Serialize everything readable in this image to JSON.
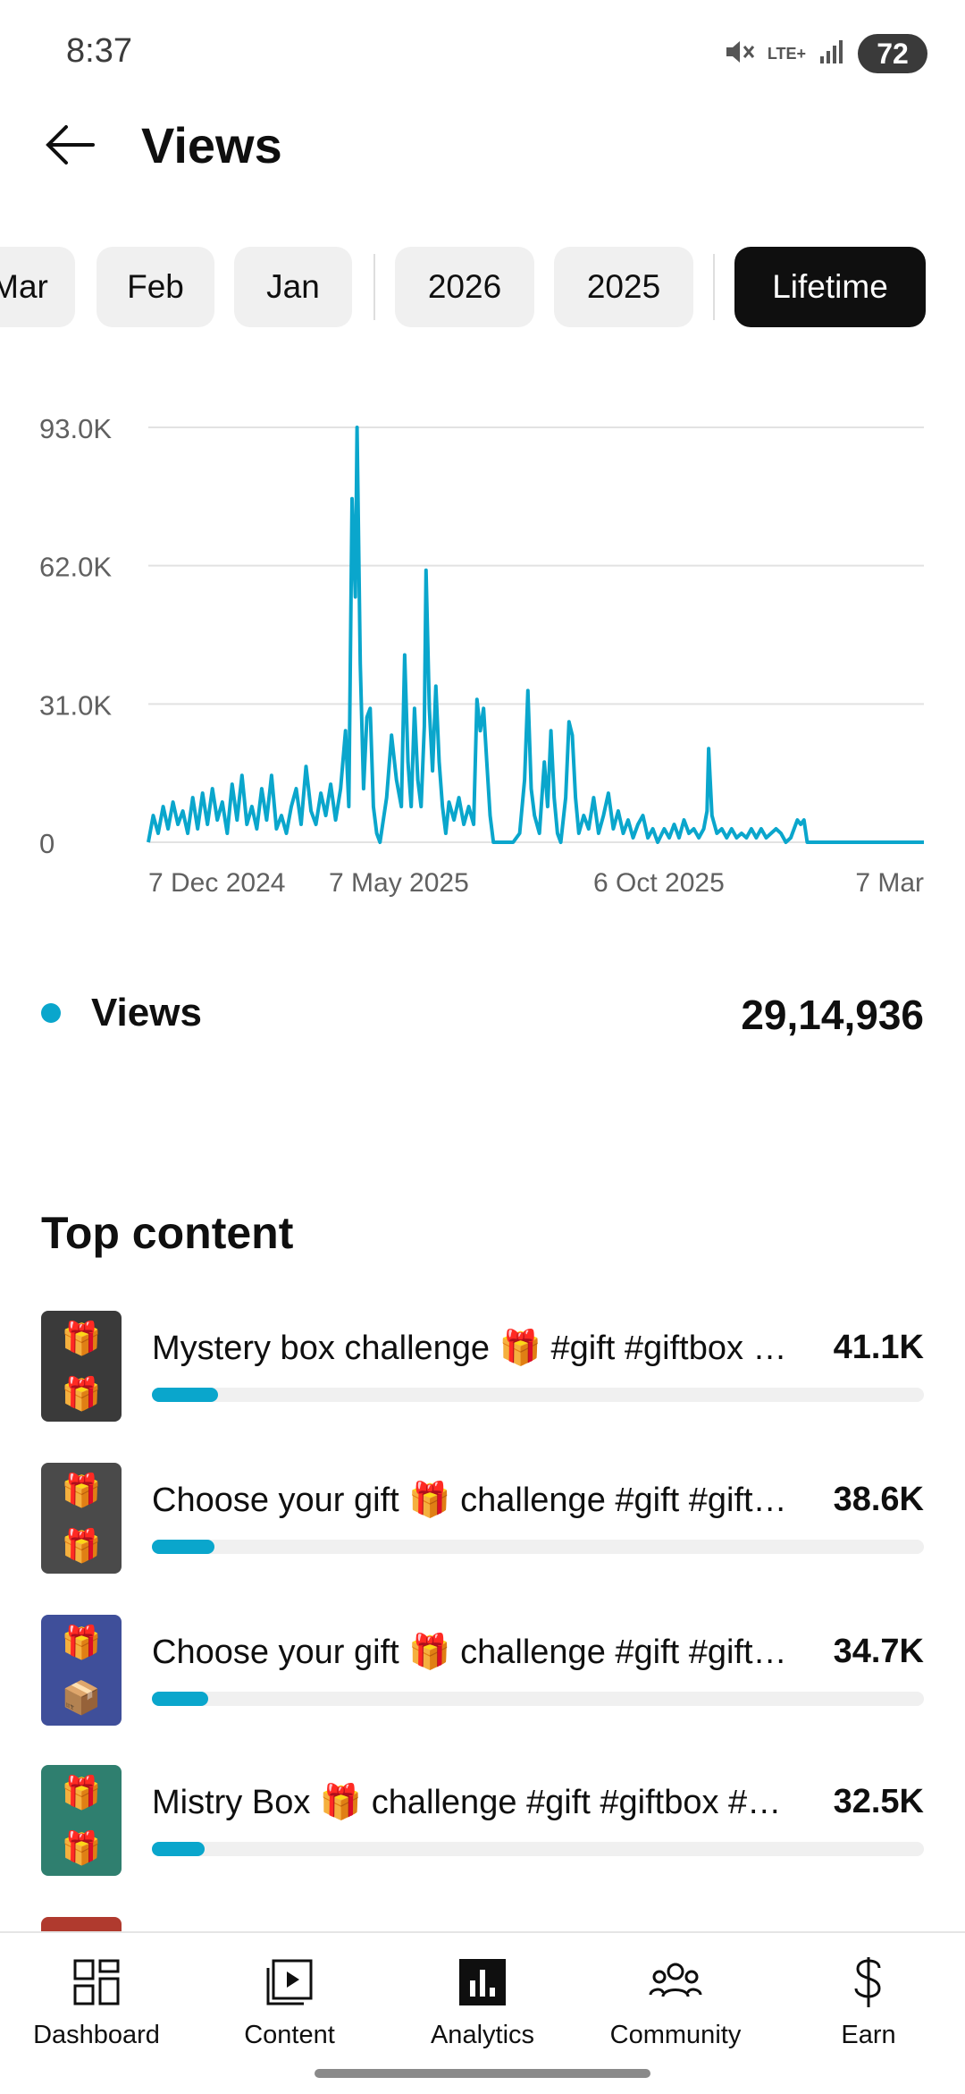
{
  "status_bar": {
    "time": "8:37",
    "network": "LTE+",
    "battery": "72"
  },
  "header": {
    "title": "Views"
  },
  "chips": [
    {
      "label": "Mar",
      "active": false
    },
    {
      "label": "Feb",
      "active": false
    },
    {
      "label": "Jan",
      "active": false
    },
    {
      "label": "2026",
      "active": false
    },
    {
      "label": "2025",
      "active": false
    },
    {
      "label": "Lifetime",
      "active": true
    }
  ],
  "chart_data": {
    "type": "line",
    "series": [
      {
        "name": "Views",
        "color": "#0aa6cc",
        "points": [
          [
            "2024-11-20",
            0
          ],
          [
            "2024-11-23",
            6000
          ],
          [
            "2024-11-26",
            2000
          ],
          [
            "2024-11-29",
            8000
          ],
          [
            "2024-12-02",
            3000
          ],
          [
            "2024-12-05",
            9000
          ],
          [
            "2024-12-08",
            4000
          ],
          [
            "2024-12-11",
            7000
          ],
          [
            "2024-12-14",
            2000
          ],
          [
            "2024-12-17",
            10000
          ],
          [
            "2024-12-20",
            3000
          ],
          [
            "2024-12-23",
            11000
          ],
          [
            "2024-12-26",
            4000
          ],
          [
            "2024-12-29",
            12000
          ],
          [
            "2025-01-01",
            5000
          ],
          [
            "2025-01-04",
            9000
          ],
          [
            "2025-01-07",
            2000
          ],
          [
            "2025-01-10",
            13000
          ],
          [
            "2025-01-13",
            5000
          ],
          [
            "2025-01-16",
            15000
          ],
          [
            "2025-01-19",
            4000
          ],
          [
            "2025-01-22",
            8000
          ],
          [
            "2025-01-25",
            3000
          ],
          [
            "2025-01-28",
            12000
          ],
          [
            "2025-01-31",
            5000
          ],
          [
            "2025-02-03",
            15000
          ],
          [
            "2025-02-06",
            3000
          ],
          [
            "2025-02-09",
            6000
          ],
          [
            "2025-02-12",
            2000
          ],
          [
            "2025-02-15",
            8000
          ],
          [
            "2025-02-18",
            12000
          ],
          [
            "2025-02-21",
            4000
          ],
          [
            "2025-02-24",
            17000
          ],
          [
            "2025-02-27",
            7000
          ],
          [
            "2025-03-02",
            4000
          ],
          [
            "2025-03-05",
            11000
          ],
          [
            "2025-03-08",
            6000
          ],
          [
            "2025-03-11",
            13000
          ],
          [
            "2025-03-14",
            5000
          ],
          [
            "2025-03-17",
            12000
          ],
          [
            "2025-03-20",
            25000
          ],
          [
            "2025-03-22",
            8000
          ],
          [
            "2025-03-24",
            77000
          ],
          [
            "2025-03-26",
            55000
          ],
          [
            "2025-03-27",
            93000
          ],
          [
            "2025-03-29",
            40000
          ],
          [
            "2025-03-31",
            12000
          ],
          [
            "2025-04-02",
            28000
          ],
          [
            "2025-04-04",
            30000
          ],
          [
            "2025-04-06",
            8000
          ],
          [
            "2025-04-08",
            2000
          ],
          [
            "2025-04-10",
            0
          ],
          [
            "2025-04-14",
            10000
          ],
          [
            "2025-04-17",
            24000
          ],
          [
            "2025-04-20",
            14000
          ],
          [
            "2025-04-23",
            8000
          ],
          [
            "2025-04-25",
            42000
          ],
          [
            "2025-04-27",
            18000
          ],
          [
            "2025-04-29",
            8000
          ],
          [
            "2025-05-01",
            30000
          ],
          [
            "2025-05-03",
            14000
          ],
          [
            "2025-05-05",
            8000
          ],
          [
            "2025-05-07",
            26000
          ],
          [
            "2025-05-08",
            61000
          ],
          [
            "2025-05-10",
            30000
          ],
          [
            "2025-05-12",
            16000
          ],
          [
            "2025-05-14",
            35000
          ],
          [
            "2025-05-16",
            18000
          ],
          [
            "2025-05-18",
            8000
          ],
          [
            "2025-05-20",
            2000
          ],
          [
            "2025-05-22",
            9000
          ],
          [
            "2025-05-25",
            5000
          ],
          [
            "2025-05-28",
            10000
          ],
          [
            "2025-05-31",
            4000
          ],
          [
            "2025-06-03",
            8000
          ],
          [
            "2025-06-06",
            4000
          ],
          [
            "2025-06-08",
            32000
          ],
          [
            "2025-06-10",
            25000
          ],
          [
            "2025-06-12",
            30000
          ],
          [
            "2025-06-14",
            18000
          ],
          [
            "2025-06-16",
            6000
          ],
          [
            "2025-06-18",
            0
          ],
          [
            "2025-06-24",
            0
          ],
          [
            "2025-06-30",
            0
          ],
          [
            "2025-07-04",
            2000
          ],
          [
            "2025-07-07",
            14000
          ],
          [
            "2025-07-09",
            34000
          ],
          [
            "2025-07-11",
            12000
          ],
          [
            "2025-07-13",
            6000
          ],
          [
            "2025-07-16",
            2000
          ],
          [
            "2025-07-19",
            18000
          ],
          [
            "2025-07-21",
            8000
          ],
          [
            "2025-07-23",
            25000
          ],
          [
            "2025-07-25",
            10000
          ],
          [
            "2025-07-27",
            2000
          ],
          [
            "2025-07-29",
            0
          ],
          [
            "2025-08-01",
            10000
          ],
          [
            "2025-08-03",
            27000
          ],
          [
            "2025-08-05",
            24000
          ],
          [
            "2025-08-07",
            10000
          ],
          [
            "2025-08-09",
            2000
          ],
          [
            "2025-08-12",
            6000
          ],
          [
            "2025-08-15",
            3000
          ],
          [
            "2025-08-18",
            10000
          ],
          [
            "2025-08-21",
            2000
          ],
          [
            "2025-08-24",
            6000
          ],
          [
            "2025-08-27",
            11000
          ],
          [
            "2025-08-30",
            3000
          ],
          [
            "2025-09-02",
            7000
          ],
          [
            "2025-09-05",
            2000
          ],
          [
            "2025-09-08",
            5000
          ],
          [
            "2025-09-11",
            1000
          ],
          [
            "2025-09-14",
            4000
          ],
          [
            "2025-09-17",
            6000
          ],
          [
            "2025-09-20",
            1000
          ],
          [
            "2025-09-23",
            3000
          ],
          [
            "2025-09-26",
            0
          ],
          [
            "2025-09-30",
            3000
          ],
          [
            "2025-10-03",
            1000
          ],
          [
            "2025-10-06",
            4000
          ],
          [
            "2025-10-09",
            1000
          ],
          [
            "2025-10-12",
            5000
          ],
          [
            "2025-10-15",
            2000
          ],
          [
            "2025-10-18",
            3000
          ],
          [
            "2025-10-21",
            1000
          ],
          [
            "2025-10-24",
            3000
          ],
          [
            "2025-10-26",
            7000
          ],
          [
            "2025-10-27",
            21000
          ],
          [
            "2025-10-29",
            6000
          ],
          [
            "2025-11-01",
            2000
          ],
          [
            "2025-11-04",
            3000
          ],
          [
            "2025-11-07",
            1000
          ],
          [
            "2025-11-10",
            3000
          ],
          [
            "2025-11-13",
            1000
          ],
          [
            "2025-11-16",
            2000
          ],
          [
            "2025-11-19",
            1000
          ],
          [
            "2025-11-22",
            3000
          ],
          [
            "2025-11-25",
            1000
          ],
          [
            "2025-11-28",
            3000
          ],
          [
            "2025-12-01",
            1000
          ],
          [
            "2025-12-04",
            2000
          ],
          [
            "2025-12-07",
            3000
          ],
          [
            "2025-12-10",
            2000
          ],
          [
            "2025-12-13",
            0
          ],
          [
            "2025-12-16",
            1000
          ],
          [
            "2025-12-18",
            3000
          ],
          [
            "2025-12-20",
            5000
          ],
          [
            "2025-12-22",
            4000
          ],
          [
            "2025-12-24",
            5000
          ],
          [
            "2025-12-26",
            0
          ],
          [
            "2026-01-15",
            0
          ],
          [
            "2026-02-15",
            0
          ],
          [
            "2026-03-07",
            0
          ]
        ]
      }
    ],
    "x_ticks": [
      "7 Dec 2024",
      "7 May 2025",
      "6 Oct 2025",
      "7 Mar"
    ],
    "y_ticks": [
      "0",
      "31.0K",
      "62.0K",
      "93.0K"
    ],
    "ylim": [
      0,
      93000
    ],
    "grid": true
  },
  "summary": {
    "label": "Views",
    "total": "29,14,936",
    "dot_color": "#0aa6cc"
  },
  "top_content": {
    "title": "Top content",
    "items": [
      {
        "title": "Mystery box challenge 🎁 #gift #giftbox #challenge",
        "value": "41.1K",
        "share": 0.086,
        "thumb_color": "#3a3a3a"
      },
      {
        "title": "Choose your gift 🎁 challenge #gift #giftbox",
        "value": "38.6K",
        "share": 0.081,
        "thumb_color": "#4a4a4a"
      },
      {
        "title": "Choose your gift 🎁 challenge #gift #giftbox",
        "value": "34.7K",
        "share": 0.073,
        "thumb_color": "#3f4f9a"
      },
      {
        "title": "Mistry Box 🎁 challenge #gift #giftbox #challenge",
        "value": "32.5K",
        "share": 0.068,
        "thumb_color": "#2f7f6f"
      }
    ]
  },
  "nav": [
    {
      "label": "Dashboard",
      "icon": "dashboard-icon",
      "active": false
    },
    {
      "label": "Content",
      "icon": "content-icon",
      "active": false
    },
    {
      "label": "Analytics",
      "icon": "analytics-icon",
      "active": true
    },
    {
      "label": "Community",
      "icon": "community-icon",
      "active": false
    },
    {
      "label": "Earn",
      "icon": "earn-icon",
      "active": false
    }
  ]
}
